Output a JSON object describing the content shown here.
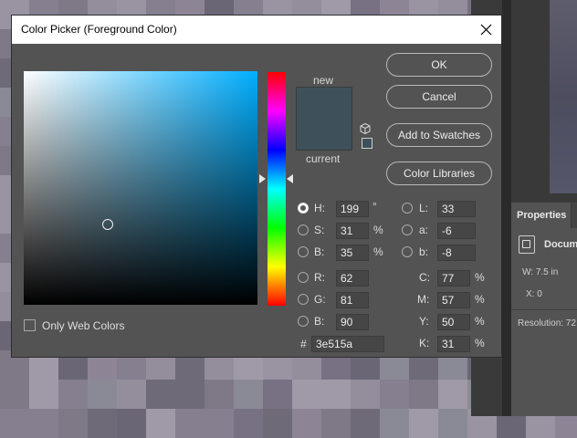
{
  "dialog": {
    "title": "Color Picker (Foreground Color)",
    "buttons": {
      "ok": "OK",
      "cancel": "Cancel",
      "add_to_swatches": "Add to Swatches",
      "color_libraries": "Color Libraries"
    },
    "swatch": {
      "new_label": "new",
      "current_label": "current",
      "new_color": "#3e515a",
      "current_color": "#3e515a"
    },
    "hsb": {
      "h": {
        "label": "H:",
        "value": "199",
        "unit": "°"
      },
      "s": {
        "label": "S:",
        "value": "31",
        "unit": "%"
      },
      "b": {
        "label": "B:",
        "value": "35",
        "unit": "%"
      }
    },
    "lab": {
      "l": {
        "label": "L:",
        "value": "33"
      },
      "a": {
        "label": "a:",
        "value": "-6"
      },
      "b": {
        "label": "b:",
        "value": "-8"
      }
    },
    "rgb": {
      "r": {
        "label": "R:",
        "value": "62"
      },
      "g": {
        "label": "G:",
        "value": "81"
      },
      "b": {
        "label": "B:",
        "value": "90"
      }
    },
    "cmyk": {
      "c": {
        "label": "C:",
        "value": "77",
        "unit": "%"
      },
      "m": {
        "label": "M:",
        "value": "57",
        "unit": "%"
      },
      "y": {
        "label": "Y:",
        "value": "50",
        "unit": "%"
      },
      "k": {
        "label": "K:",
        "value": "31",
        "unit": "%"
      }
    },
    "hex": {
      "label": "#",
      "value": "3e515a"
    },
    "only_web_colors": {
      "label": "Only Web Colors",
      "checked": false
    }
  },
  "properties_panel": {
    "tab_label": "Properties",
    "document_label": "Docum",
    "width_line": "W: 7.5 in",
    "x_line": "X: 0",
    "resolution_line": "Resolution: 72"
  },
  "colors": {
    "dialog_bg": "#535353",
    "selected_color": "#3e515a",
    "hue_color": "#00aeff"
  }
}
